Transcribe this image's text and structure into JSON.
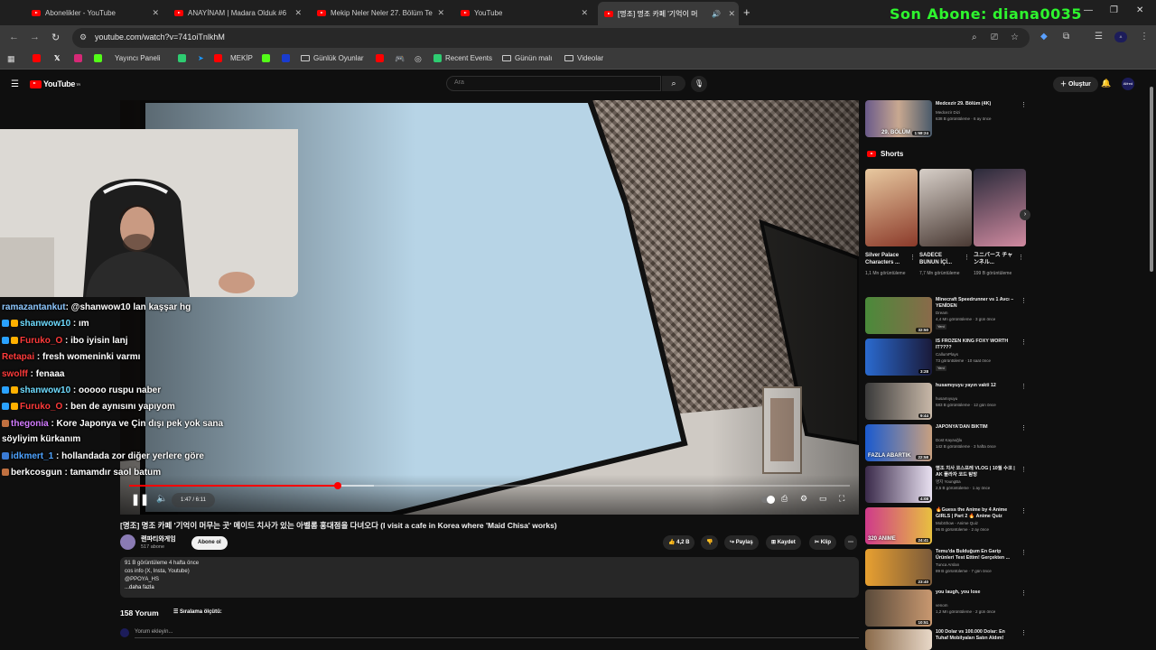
{
  "browser": {
    "tabs": [
      {
        "label": "Abonelikler - YouTube",
        "active": false
      },
      {
        "label": "ANAYİNAM | Madara Olduk #6",
        "active": false
      },
      {
        "label": "Mekip Neler Neler 27. Bölüm Te",
        "active": false
      },
      {
        "label": "YouTube",
        "active": false
      },
      {
        "label": "[명조] 명조 카페 '기억이 머",
        "active": true
      }
    ],
    "overlay_text": "Son Abone: diana0035",
    "url": "youtube.com/watch?v=741oiTnlkhM",
    "bookmarks": [
      {
        "label": "",
        "icon": "youtube-icon",
        "color": "#ff0000"
      },
      {
        "label": "",
        "icon": "x-icon",
        "color": "#ffffff"
      },
      {
        "label": "",
        "icon": "instagram-icon",
        "color": "#d62976"
      },
      {
        "label": "Yayıncı Paneli",
        "icon": "kick-icon",
        "color": "#53fc18"
      },
      {
        "label": "",
        "icon": "app-icon",
        "color": "#2ecc71"
      },
      {
        "label": "",
        "icon": "prime-icon",
        "color": "#1a98ff"
      },
      {
        "label": "MEKİP",
        "icon": "youtube-icon",
        "color": "#ff0000"
      },
      {
        "label": "",
        "icon": "kick-icon",
        "color": "#53fc18"
      },
      {
        "label": "",
        "icon": "blue-icon",
        "color": "#1a3ccf"
      },
      {
        "label": "Günlük Oyunlar",
        "icon": "folder-icon",
        "color": "#cccccc"
      },
      {
        "label": "",
        "icon": "youtube-icon",
        "color": "#ff0000"
      },
      {
        "label": "",
        "icon": "controller-icon",
        "color": "#ffffff"
      },
      {
        "label": "",
        "icon": "globe-icon",
        "color": "#cccccc"
      },
      {
        "label": "Recent Events",
        "icon": "app-icon",
        "color": "#2ecc71"
      },
      {
        "label": "Günün malı",
        "icon": "folder-icon",
        "color": "#cccccc"
      },
      {
        "label": "Videolar",
        "icon": "folder-icon",
        "color": "#cccccc"
      }
    ]
  },
  "youtube": {
    "logo": "YouTube",
    "logo_suffix": "TR",
    "search_placeholder": "Ara",
    "create_label": "Oluştur",
    "avatar_label": "Alfred"
  },
  "player": {
    "time": "1:47 / 6:11",
    "progress": 0.289,
    "buffered": 0.34
  },
  "chat": [
    {
      "user": "ramazantankut",
      "msg": ": @shanwow10 lan kaşşar hg",
      "color": "#8ec8ff",
      "badges": []
    },
    {
      "user": "shanwow10",
      "msg": " : ım",
      "color": "#6fdcff",
      "badges": [
        "#2aa2ff",
        "#ffb000"
      ]
    },
    {
      "user": "Furuko_O",
      "msg": " : ibo iyisin lanj",
      "color": "#ff3b3b",
      "badges": [
        "#2aa2ff",
        "#ffb000"
      ]
    },
    {
      "user": "Retapai",
      "msg": " : fresh womeninki varmı",
      "color": "#ff3b3b",
      "badges": []
    },
    {
      "user": "swolff",
      "msg": " : fenaaa",
      "color": "#ff3b3b",
      "badges": []
    },
    {
      "user": "shanwow10",
      "msg": " : ooooo ruspu naber",
      "color": "#6fdcff",
      "badges": [
        "#2aa2ff",
        "#ffb000"
      ]
    },
    {
      "user": "Furuko_O",
      "msg": " : ben de aynısını yapıyom",
      "color": "#ff3b3b",
      "badges": [
        "#2aa2ff",
        "#ffb000"
      ]
    },
    {
      "user": "thegonia",
      "msg": " : Kore Japonya ve Çin dışı pek yok sana",
      "color": "#d27bff",
      "badges": [
        "#c07040"
      ]
    },
    {
      "user": "",
      "msg": "söyliyim kürkanım",
      "color": "#ffffff",
      "badges": []
    },
    {
      "user": "idkmert_1",
      "msg": " : hollandada zor diğer yerlere göre",
      "color": "#4ea3ff",
      "badges": [
        "#3a7bd5"
      ]
    },
    {
      "user": "berkcosgun",
      "msg": " : tamamdır saol batum",
      "color": "#ffffff",
      "badges": [
        "#c07040"
      ]
    }
  ],
  "video": {
    "title": "[명조] 명조 카페 '기억이 머무는 곳' 메이드 치사가 있는 아벨롬 홍대점을 다녀오다 (I visit a cafe in Korea where 'Maid Chisa' works)",
    "channel": "랜파티와게임",
    "subscribers": "517 abone",
    "subscribe_label": "Abone ol",
    "likes": "4,2 B",
    "share_label": "Paylaş",
    "save_label": "Kaydet",
    "clip_label": "Klip",
    "description": {
      "stats": "91 B görüntüleme  4 hafta önce",
      "lines": [
        "cos info (X, Insta, Youtube)",
        "@PPOYA_HS"
      ],
      "more": "...daha fazla"
    },
    "comments_count": "158 Yorum",
    "sort_label": "Sıralama ölçütü:",
    "comment_placeholder": "Yorum ekleyin..."
  },
  "sidebar": {
    "top_rec": {
      "title": "Medcezir 29. Bölüm (4K)",
      "channel": "Medcezir Dizi",
      "meta": "638 B görüntüleme · 6 ay önce",
      "duration": "1:58:24",
      "thumb_text": "29. BÖLÜM"
    },
    "shorts_label": "Shorts",
    "shorts": [
      {
        "title": "Silver Palace Characters ...",
        "views": "1,1 Mn görüntüleme",
        "colors": [
          "#e8c9a0",
          "#8b3a2a"
        ]
      },
      {
        "title": "SADECE BUNUN İÇİ...",
        "views": "7,7 Mn görüntüleme",
        "colors": [
          "#d7cfc8",
          "#4a3a34"
        ]
      },
      {
        "title": "ユニバース チャンネル...",
        "views": "199 B görüntüleme",
        "colors": [
          "#2a2a3a",
          "#d08aa0"
        ]
      }
    ],
    "recs": [
      {
        "title": "Minecraft Speedrunner vs 1 Avcı – YENİDEN",
        "channel": "Dream",
        "meta": "4,4 Mn görüntüleme · 3 gün önce",
        "badge": "Yeni",
        "duration": "32:50",
        "colors": [
          "#4a8a3a",
          "#8a6a4a"
        ]
      },
      {
        "title": "IS FROZEN KING FOXY WORTH IT????",
        "channel": "CallumPlays",
        "meta": "73 görüntüleme · 10 saat önce",
        "badge": "Yeni",
        "duration": "3:28",
        "colors": [
          "#2a6acf",
          "#1a1a3a"
        ]
      },
      {
        "title": "husamıyuyu yayın vakti 12",
        "channel": "husamıyuyu",
        "meta": "583 B görüntüleme · 12 gün önce",
        "badge": "",
        "duration": "9:44",
        "colors": [
          "#3a3a3a",
          "#c8b8a8"
        ]
      },
      {
        "title": "JAPONYA'DAN BIKTIM",
        "channel": "Dost Kayaoğlu",
        "meta": "142 B görüntüleme · 3 hafta önce",
        "badge": "",
        "duration": "22:58",
        "colors": [
          "#1a5acf",
          "#c8a080"
        ],
        "thumb_text": "FAZLA ABARTIK"
      },
      {
        "title": "명조 치사 코스프레 VLOG | 10월 수코 | AK 플라자 코드 탐방",
        "channel": "명지 YoungBa",
        "meta": "2,5 B görüntüleme · 1 ay önce",
        "badge": "",
        "duration": "4:08",
        "colors": [
          "#3a2a4a",
          "#e8e0f0"
        ]
      },
      {
        "title": "🔥Guess the Anime by 4 Anime GIRLS | Part 2 🔥 Anime Quiz",
        "channel": "MobShow - Anime Quiz",
        "meta": "95 B görüntüleme · 2 ay önce",
        "badge": "",
        "duration": "24:41",
        "colors": [
          "#cf3a8a",
          "#e8c040"
        ],
        "thumb_text": "320 ANIME"
      },
      {
        "title": "Temu'da Bulduğum En Garip Ürünleri Test Ettim! Gerçekten ...",
        "channel": "Tunca Arslan",
        "meta": "89 B görüntüleme · 7 gün önce",
        "badge": "",
        "duration": "23:40",
        "colors": [
          "#e8a030",
          "#7a5a3a"
        ]
      },
      {
        "title": "you laugh, you lose",
        "channel": "venom",
        "meta": "1,2 Mn görüntüleme · 2 gün önce",
        "badge": "",
        "duration": "10:51",
        "colors": [
          "#5a4a3a",
          "#c89870"
        ]
      },
      {
        "title": "100 Dolar vs 100.000 Dolar: En Tuhaf Mobilyaları Satın Aldım!",
        "channel": "",
        "meta": "",
        "badge": "",
        "duration": "",
        "colors": [
          "#8a6a4a",
          "#e8d8c8"
        ]
      }
    ]
  }
}
